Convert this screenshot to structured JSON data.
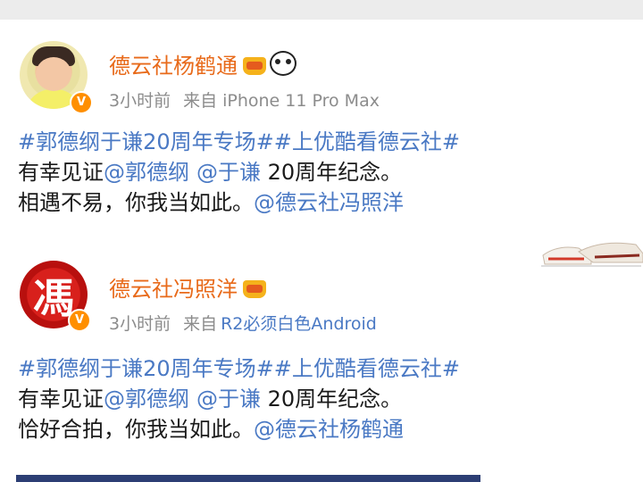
{
  "posts": [
    {
      "author": "德云社杨鹤通",
      "time": "3小时前",
      "source_prefix": "来自",
      "source": "iPhone 11 Pro Max",
      "hashtag": "#郭德纲于谦20周年专场##上优酷看德云社#",
      "line2_prefix": "有幸见证",
      "mention1": "@郭德纲",
      "mention2": "@于谦",
      "line2_suffix": " 20周年纪念。",
      "line3_prefix": "相遇不易，你我当如此。",
      "line3_mention": "@德云社冯照洋",
      "icons": [
        "crown-badge-icon",
        "panda-icon",
        "verified-v-icon"
      ]
    },
    {
      "author": "德云社冯照洋",
      "avatar_glyph": "馮",
      "time": "3小时前",
      "source_prefix": "来自",
      "source": "R2必须白色Android",
      "hashtag": "#郭德纲于谦20周年专场##上优酷看德云社#",
      "line2_prefix": "有幸见证",
      "mention1": "@郭德纲",
      "mention2": "@于谦",
      "line2_suffix": " 20周年纪念。",
      "line3_prefix": "恰好合拍，你我当如此。",
      "line3_mention": "@德云社杨鹤通",
      "icons": [
        "crown-badge-icon",
        "verified-v-icon"
      ]
    }
  ],
  "verified_badge": "V",
  "colors": {
    "author": "#e86a1a",
    "link": "#4a79c4",
    "meta": "#8c8c8c",
    "badge": "#ff8f00"
  }
}
